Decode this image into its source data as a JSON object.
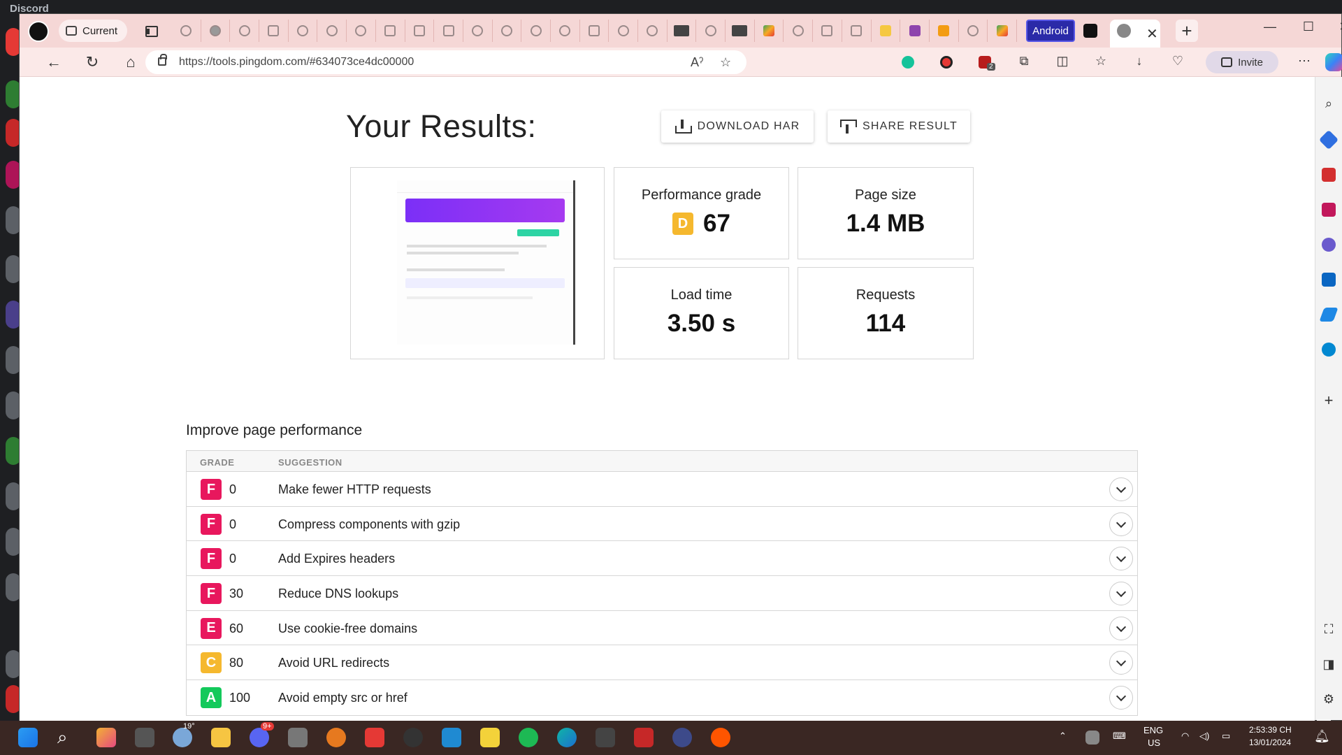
{
  "background": {
    "title": "Discord"
  },
  "browser": {
    "workspace_label": "Current",
    "android_tab_label": "Android",
    "url": "https://tools.pingdom.com/#634073ce4dc00000",
    "invite_label": "Invite",
    "badge_count": "2"
  },
  "page": {
    "results_title": "Your Results:",
    "download_har_label": "DOWNLOAD HAR",
    "share_result_label": "SHARE RESULT",
    "metrics": {
      "performance_label": "Performance grade",
      "performance_grade": "D",
      "performance_score": "67",
      "page_size_label": "Page size",
      "page_size_value": "1.4 MB",
      "load_time_label": "Load time",
      "load_time_value": "3.50 s",
      "requests_label": "Requests",
      "requests_value": "114"
    },
    "improve_title": "Improve page performance",
    "table_headers": {
      "grade": "GRADE",
      "suggestion": "SUGGESTION"
    },
    "suggestions": [
      {
        "grade": "F",
        "score": "0",
        "text": "Make fewer HTTP requests",
        "color": "#e8175d"
      },
      {
        "grade": "F",
        "score": "0",
        "text": "Compress components with gzip",
        "color": "#e8175d"
      },
      {
        "grade": "F",
        "score": "0",
        "text": "Add Expires headers",
        "color": "#e8175d"
      },
      {
        "grade": "F",
        "score": "30",
        "text": "Reduce DNS lookups",
        "color": "#e8175d"
      },
      {
        "grade": "E",
        "score": "60",
        "text": "Use cookie-free domains",
        "color": "#e8175d"
      },
      {
        "grade": "C",
        "score": "80",
        "text": "Avoid URL redirects",
        "color": "#f5b82e"
      },
      {
        "grade": "A",
        "score": "100",
        "text": "Avoid empty src or href",
        "color": "#13c95b"
      }
    ],
    "grade_d_color": "#f5b82e"
  },
  "taskbar": {
    "weather_temp": "19°",
    "discord_badge": "9+",
    "lang_top": "ENG",
    "lang_bottom": "US",
    "time": "2:53:39 CH",
    "date": "13/01/2024"
  }
}
